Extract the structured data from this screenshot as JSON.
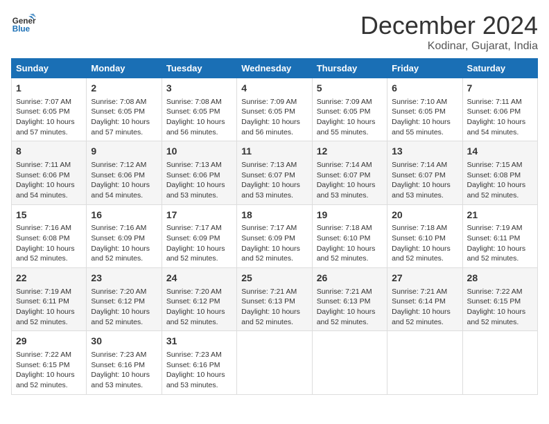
{
  "logo": {
    "line1": "General",
    "line2": "Blue"
  },
  "title": "December 2024",
  "subtitle": "Kodinar, Gujarat, India",
  "days_of_week": [
    "Sunday",
    "Monday",
    "Tuesday",
    "Wednesday",
    "Thursday",
    "Friday",
    "Saturday"
  ],
  "weeks": [
    [
      {
        "day": "1",
        "info": "Sunrise: 7:07 AM\nSunset: 6:05 PM\nDaylight: 10 hours\nand 57 minutes."
      },
      {
        "day": "2",
        "info": "Sunrise: 7:08 AM\nSunset: 6:05 PM\nDaylight: 10 hours\nand 57 minutes."
      },
      {
        "day": "3",
        "info": "Sunrise: 7:08 AM\nSunset: 6:05 PM\nDaylight: 10 hours\nand 56 minutes."
      },
      {
        "day": "4",
        "info": "Sunrise: 7:09 AM\nSunset: 6:05 PM\nDaylight: 10 hours\nand 56 minutes."
      },
      {
        "day": "5",
        "info": "Sunrise: 7:09 AM\nSunset: 6:05 PM\nDaylight: 10 hours\nand 55 minutes."
      },
      {
        "day": "6",
        "info": "Sunrise: 7:10 AM\nSunset: 6:05 PM\nDaylight: 10 hours\nand 55 minutes."
      },
      {
        "day": "7",
        "info": "Sunrise: 7:11 AM\nSunset: 6:06 PM\nDaylight: 10 hours\nand 54 minutes."
      }
    ],
    [
      {
        "day": "8",
        "info": "Sunrise: 7:11 AM\nSunset: 6:06 PM\nDaylight: 10 hours\nand 54 minutes."
      },
      {
        "day": "9",
        "info": "Sunrise: 7:12 AM\nSunset: 6:06 PM\nDaylight: 10 hours\nand 54 minutes."
      },
      {
        "day": "10",
        "info": "Sunrise: 7:13 AM\nSunset: 6:06 PM\nDaylight: 10 hours\nand 53 minutes."
      },
      {
        "day": "11",
        "info": "Sunrise: 7:13 AM\nSunset: 6:07 PM\nDaylight: 10 hours\nand 53 minutes."
      },
      {
        "day": "12",
        "info": "Sunrise: 7:14 AM\nSunset: 6:07 PM\nDaylight: 10 hours\nand 53 minutes."
      },
      {
        "day": "13",
        "info": "Sunrise: 7:14 AM\nSunset: 6:07 PM\nDaylight: 10 hours\nand 53 minutes."
      },
      {
        "day": "14",
        "info": "Sunrise: 7:15 AM\nSunset: 6:08 PM\nDaylight: 10 hours\nand 52 minutes."
      }
    ],
    [
      {
        "day": "15",
        "info": "Sunrise: 7:16 AM\nSunset: 6:08 PM\nDaylight: 10 hours\nand 52 minutes."
      },
      {
        "day": "16",
        "info": "Sunrise: 7:16 AM\nSunset: 6:09 PM\nDaylight: 10 hours\nand 52 minutes."
      },
      {
        "day": "17",
        "info": "Sunrise: 7:17 AM\nSunset: 6:09 PM\nDaylight: 10 hours\nand 52 minutes."
      },
      {
        "day": "18",
        "info": "Sunrise: 7:17 AM\nSunset: 6:09 PM\nDaylight: 10 hours\nand 52 minutes."
      },
      {
        "day": "19",
        "info": "Sunrise: 7:18 AM\nSunset: 6:10 PM\nDaylight: 10 hours\nand 52 minutes."
      },
      {
        "day": "20",
        "info": "Sunrise: 7:18 AM\nSunset: 6:10 PM\nDaylight: 10 hours\nand 52 minutes."
      },
      {
        "day": "21",
        "info": "Sunrise: 7:19 AM\nSunset: 6:11 PM\nDaylight: 10 hours\nand 52 minutes."
      }
    ],
    [
      {
        "day": "22",
        "info": "Sunrise: 7:19 AM\nSunset: 6:11 PM\nDaylight: 10 hours\nand 52 minutes."
      },
      {
        "day": "23",
        "info": "Sunrise: 7:20 AM\nSunset: 6:12 PM\nDaylight: 10 hours\nand 52 minutes."
      },
      {
        "day": "24",
        "info": "Sunrise: 7:20 AM\nSunset: 6:12 PM\nDaylight: 10 hours\nand 52 minutes."
      },
      {
        "day": "25",
        "info": "Sunrise: 7:21 AM\nSunset: 6:13 PM\nDaylight: 10 hours\nand 52 minutes."
      },
      {
        "day": "26",
        "info": "Sunrise: 7:21 AM\nSunset: 6:13 PM\nDaylight: 10 hours\nand 52 minutes."
      },
      {
        "day": "27",
        "info": "Sunrise: 7:21 AM\nSunset: 6:14 PM\nDaylight: 10 hours\nand 52 minutes."
      },
      {
        "day": "28",
        "info": "Sunrise: 7:22 AM\nSunset: 6:15 PM\nDaylight: 10 hours\nand 52 minutes."
      }
    ],
    [
      {
        "day": "29",
        "info": "Sunrise: 7:22 AM\nSunset: 6:15 PM\nDaylight: 10 hours\nand 52 minutes."
      },
      {
        "day": "30",
        "info": "Sunrise: 7:23 AM\nSunset: 6:16 PM\nDaylight: 10 hours\nand 53 minutes."
      },
      {
        "day": "31",
        "info": "Sunrise: 7:23 AM\nSunset: 6:16 PM\nDaylight: 10 hours\nand 53 minutes."
      },
      {
        "day": "",
        "info": ""
      },
      {
        "day": "",
        "info": ""
      },
      {
        "day": "",
        "info": ""
      },
      {
        "day": "",
        "info": ""
      }
    ]
  ]
}
